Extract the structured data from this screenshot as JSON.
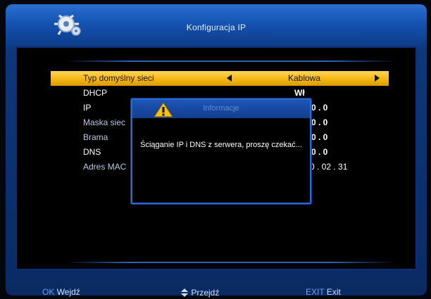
{
  "header": {
    "title": "Konfiguracja IP"
  },
  "menu": {
    "rows": [
      {
        "label": "Typ domyślny sieci",
        "value": "Kablowa"
      },
      {
        "label": "DHCP",
        "value": "Wł"
      },
      {
        "label": "IP",
        "value": "0  .  0"
      },
      {
        "label": "Maska siec",
        "value": "0  .  0"
      },
      {
        "label": "Brama",
        "value": "0  .  0"
      },
      {
        "label": "DNS",
        "value": "0  .  0"
      },
      {
        "label": "Adres MAC",
        "value": ")0 . 02 . 31"
      }
    ]
  },
  "dialog": {
    "title": "Informacje",
    "message": "Ściąganie IP i DNS z serwera, proszę czekać..."
  },
  "footer": {
    "ok_key": "OK",
    "ok_label": "Wejdź",
    "nav_label": "Przejdź",
    "exit_key": "EXIT",
    "exit_label": "Exit"
  },
  "colors": {
    "frame": "#0e3a7e",
    "selected_row": "#f4b714",
    "dialog_border": "#2b6ad3"
  },
  "icons": [
    "settings-gear-icon",
    "warning-icon",
    "left-arrow-icon",
    "right-arrow-icon",
    "up-down-icon"
  ]
}
